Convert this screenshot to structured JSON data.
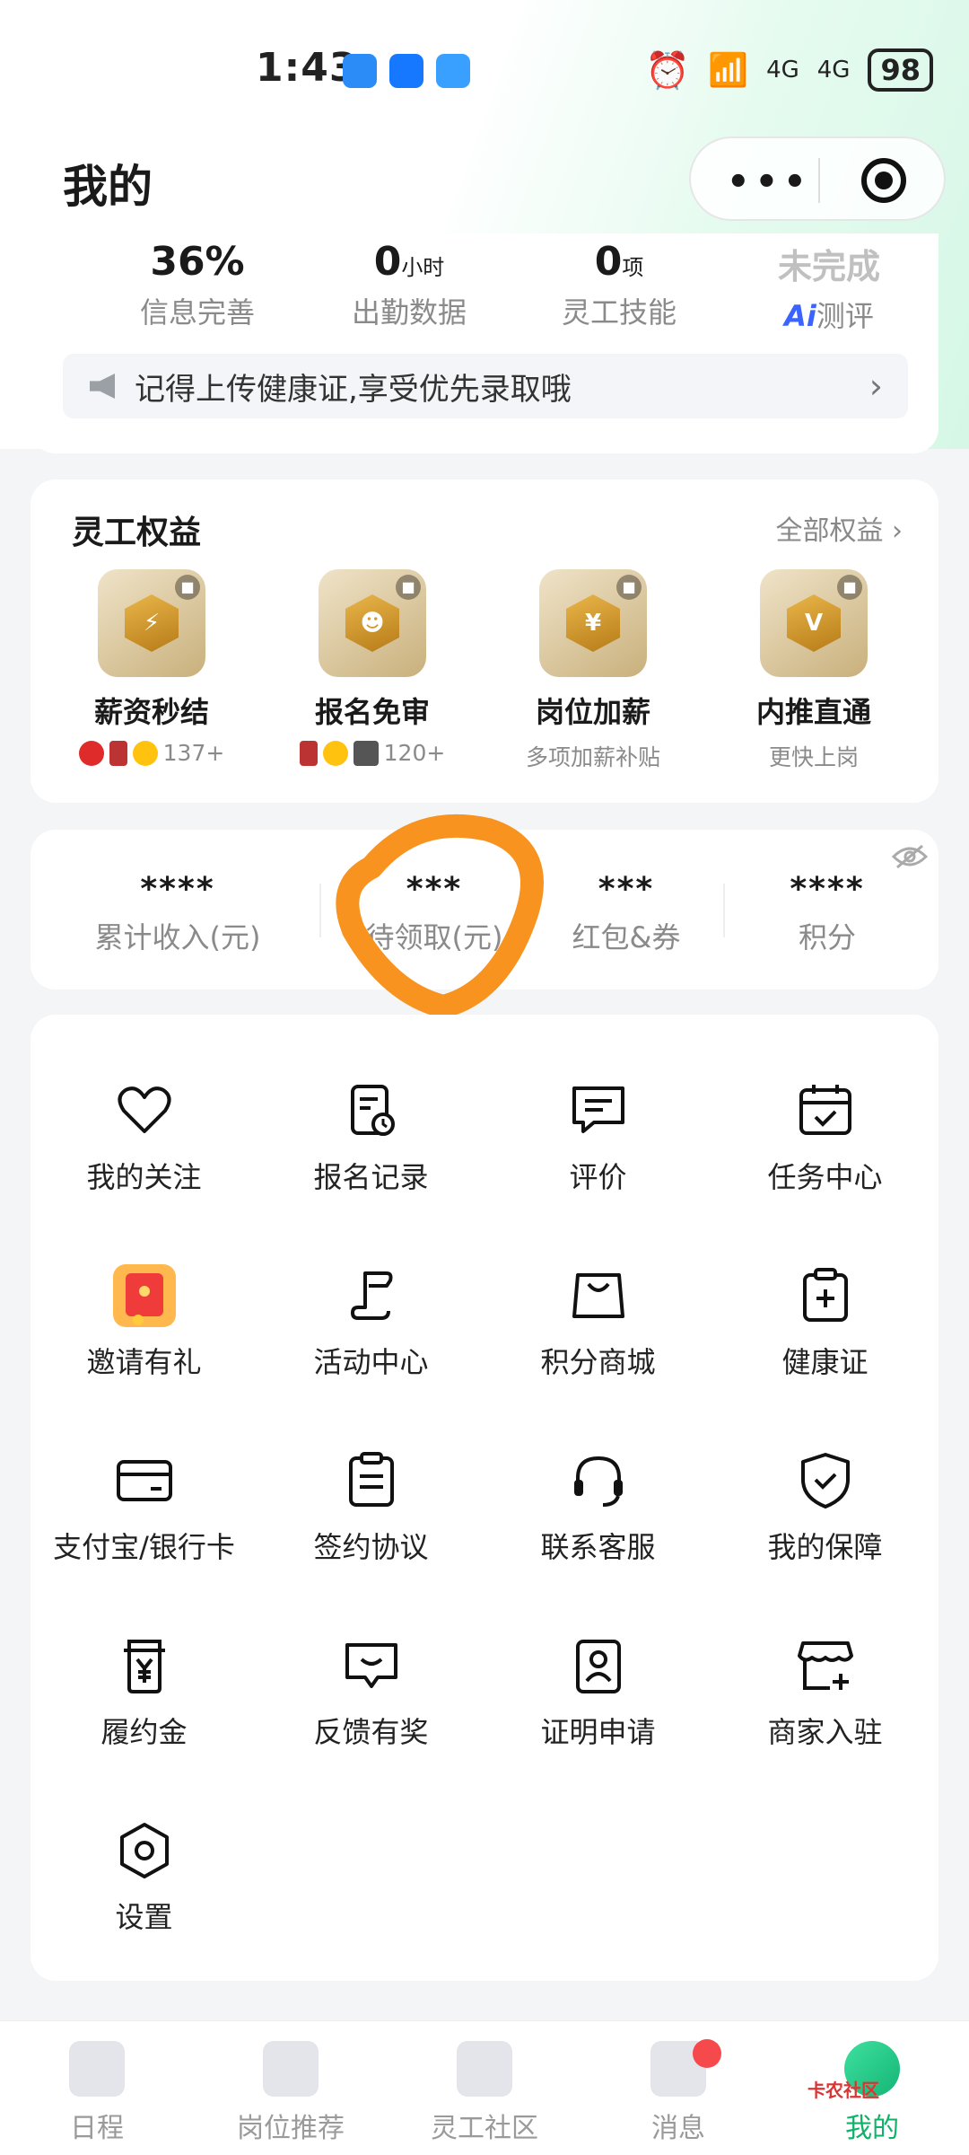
{
  "status_bar": {
    "time": "1:43",
    "battery": "98",
    "signal_label": "4G"
  },
  "header": {
    "title": "我的",
    "more_label": "•••"
  },
  "profile_stats": [
    {
      "value": "36%",
      "unit": "",
      "label": "信息完善"
    },
    {
      "value": "0",
      "unit": "小时",
      "label": "出勤数据"
    },
    {
      "value": "0",
      "unit": "项",
      "label": "灵工技能"
    },
    {
      "value": "未完成",
      "unit": "",
      "label_prefix": "Ai",
      "label": "测评"
    }
  ],
  "notice": {
    "text": "记得上传健康证,享受优先录取哦",
    "arrow": "›"
  },
  "rights": {
    "title": "灵工权益",
    "all_label": "全部权益",
    "items": [
      {
        "name": "薪资秒结",
        "sub": "137+",
        "glyph": "⚡"
      },
      {
        "name": "报名免审",
        "sub": "120+",
        "glyph": "☻"
      },
      {
        "name": "岗位加薪",
        "sub": "多项加薪补贴",
        "glyph": "¥"
      },
      {
        "name": "内推直通",
        "sub": "更快上岗",
        "glyph": "V"
      }
    ]
  },
  "wallet": [
    {
      "value": "****",
      "label": "累计收入(元)"
    },
    {
      "value": "***",
      "label": "待领取(元)"
    },
    {
      "value": "***",
      "label": "红包&券"
    },
    {
      "value": "****",
      "label": "积分"
    }
  ],
  "menu": [
    {
      "label": "我的关注",
      "icon": "heart-icon"
    },
    {
      "label": "报名记录",
      "icon": "record-icon"
    },
    {
      "label": "评价",
      "icon": "comment-icon"
    },
    {
      "label": "任务中心",
      "icon": "calendar-check-icon"
    },
    {
      "label": "邀请有礼",
      "icon": "red-envelope-icon"
    },
    {
      "label": "活动中心",
      "icon": "flag-icon"
    },
    {
      "label": "积分商城",
      "icon": "shopping-bag-icon"
    },
    {
      "label": "健康证",
      "icon": "clipboard-plus-icon"
    },
    {
      "label": "支付宝/银行卡",
      "icon": "card-icon"
    },
    {
      "label": "签约协议",
      "icon": "document-icon"
    },
    {
      "label": "联系客服",
      "icon": "headset-icon"
    },
    {
      "label": "我的保障",
      "icon": "shield-icon"
    },
    {
      "label": "履约金",
      "icon": "yuan-bag-icon"
    },
    {
      "label": "反馈有奖",
      "icon": "feedback-icon"
    },
    {
      "label": "证明申请",
      "icon": "id-badge-icon"
    },
    {
      "label": "商家入驻",
      "icon": "store-plus-icon"
    },
    {
      "label": "设置",
      "icon": "settings-icon"
    }
  ],
  "tabbar": [
    {
      "label": "日程",
      "active": false
    },
    {
      "label": "岗位推荐",
      "active": false
    },
    {
      "label": "灵工社区",
      "active": false
    },
    {
      "label": "消息",
      "active": false
    },
    {
      "label": "我的",
      "active": true
    }
  ],
  "watermark": "卡农社区",
  "colors": {
    "accent": "#10b26a",
    "badge": "#f5494c",
    "ai": "#3a63ff",
    "scribble": "#f7931e"
  }
}
